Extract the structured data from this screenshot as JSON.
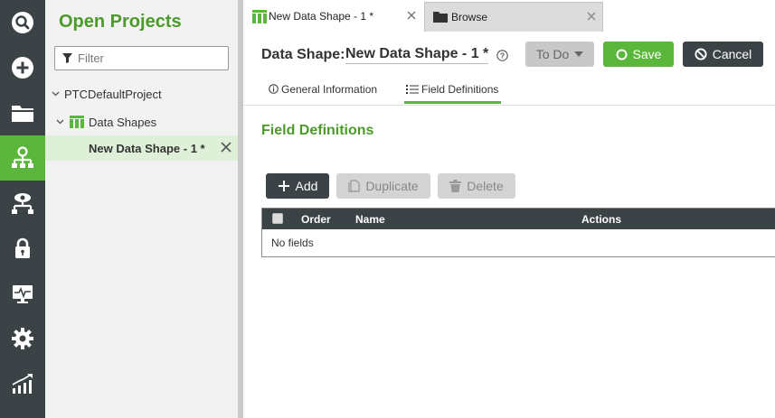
{
  "rail": {
    "items": [
      {
        "icon": "search-icon"
      },
      {
        "icon": "add-icon"
      },
      {
        "icon": "folder-icon"
      },
      {
        "icon": "model-hierarchy-icon",
        "active": true
      },
      {
        "icon": "visibility-icon"
      },
      {
        "icon": "lock-icon"
      },
      {
        "icon": "monitoring-icon"
      },
      {
        "icon": "gear-icon"
      },
      {
        "icon": "analytics-icon"
      }
    ],
    "accent": "#5bb73b",
    "background": "#3c4347"
  },
  "projects": {
    "title": "Open Projects",
    "filter_placeholder": "Filter",
    "filter_value": "",
    "tree": {
      "project": "PTCDefaultProject",
      "group": "Data Shapes",
      "item": "New Data Shape - 1 *"
    }
  },
  "tabs": [
    {
      "label": "New Data Shape - 1 *",
      "active": true,
      "icon": "data-shape-icon"
    },
    {
      "label": "Browse",
      "active": false,
      "icon": "folder-icon"
    }
  ],
  "header": {
    "label": "Data Shape:",
    "name": "New Data Shape - 1 *",
    "todo_label": "To Do",
    "save_label": "Save",
    "cancel_label": "Cancel"
  },
  "subtabs": [
    {
      "label": "General Information",
      "active": false
    },
    {
      "label": "Field Definitions",
      "active": true
    }
  ],
  "content": {
    "section_title": "Field Definitions",
    "toolbar": {
      "add_label": "Add",
      "duplicate_label": "Duplicate",
      "delete_label": "Delete"
    },
    "grid": {
      "columns": [
        "Order",
        "Name",
        "Actions"
      ],
      "empty_text": "No fields"
    }
  },
  "colors": {
    "brand_green": "#4c9a2a",
    "button_green": "#5bb73b",
    "dark": "#3c4347",
    "selected_row": "#dff0d8"
  }
}
